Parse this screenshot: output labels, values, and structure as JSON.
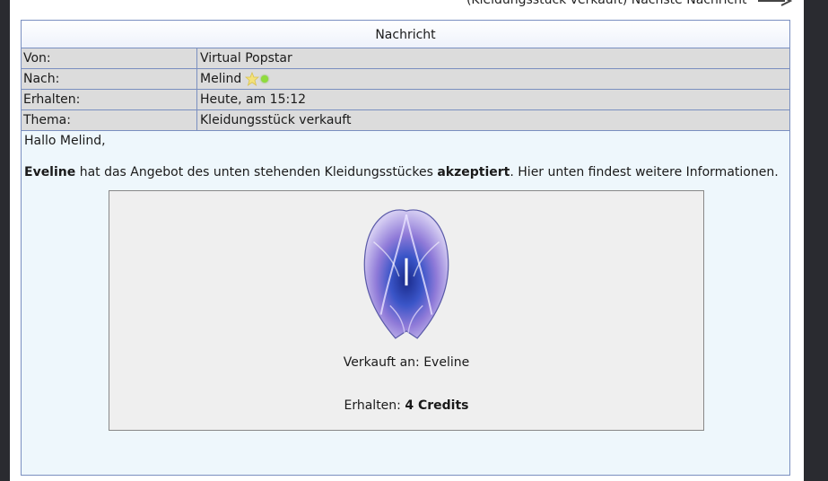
{
  "topnav": {
    "text": "(Kleidungsstück verkauft) Nächste Nachricht"
  },
  "message": {
    "header": "Nachricht",
    "rows": [
      {
        "key": "Von:",
        "value": "Virtual Popstar"
      },
      {
        "key": "Nach:",
        "value": "Melind"
      },
      {
        "key": "Erhalten:",
        "value": "Heute, am 15:12"
      },
      {
        "key": "Thema:",
        "value": "Kleidungsstück verkauft"
      }
    ],
    "greeting": "Hallo Melind,",
    "buyer": "Eveline",
    "text_mid": " hat das Angebot des unten stehenden Kleidungsstückes ",
    "accepted": "akzeptiert",
    "text_end": ". Hier unten findest weitere Informationen.",
    "card": {
      "sold_label": "Verkauft an: ",
      "sold_to": "Eveline",
      "earn_label": "Erhalten: ",
      "earn_value": "4 Credits"
    }
  },
  "icons": [
    "arrow-right-icon",
    "star-icon",
    "online-dot-icon",
    "clothing-item-image"
  ],
  "colors": {
    "border": "#7a8fc0",
    "row_bg": "#dcdcdc",
    "body_bg": "#eef7fc",
    "online": "#8fdc3c"
  }
}
